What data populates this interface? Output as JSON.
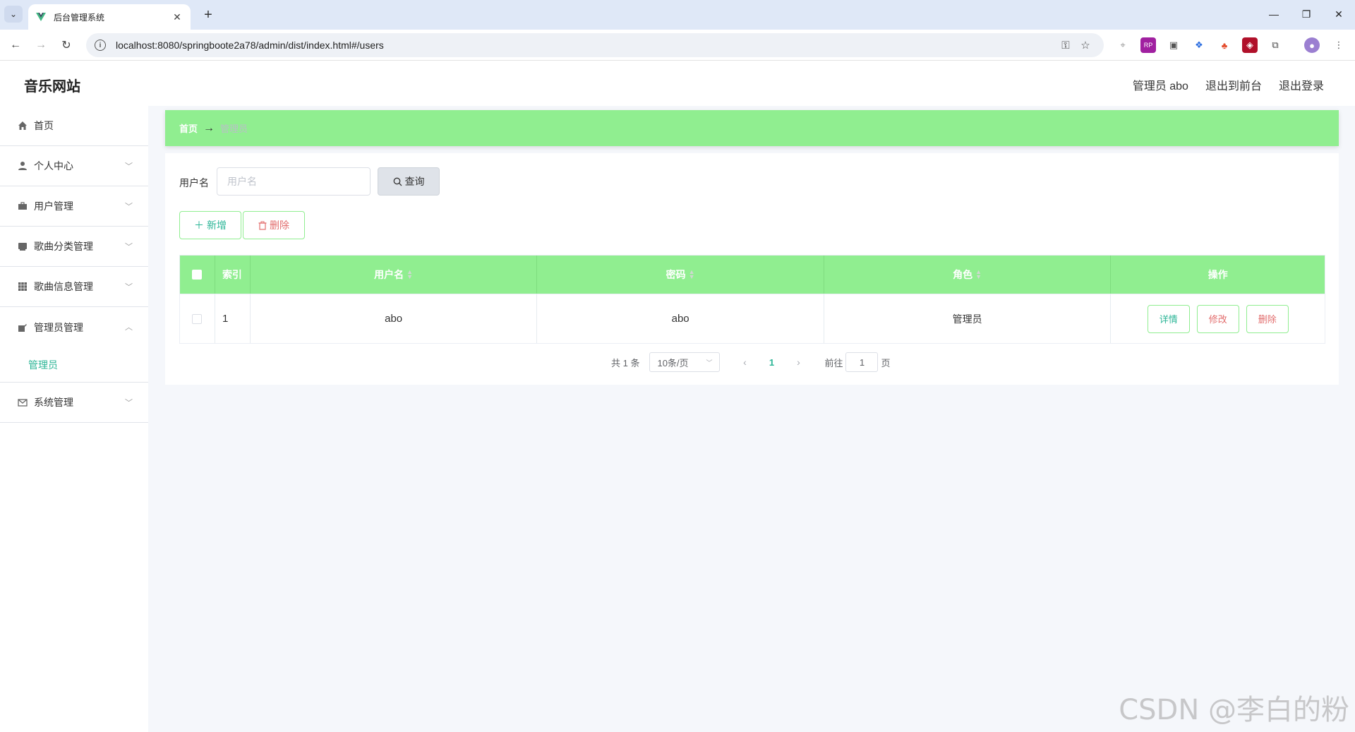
{
  "browser": {
    "tab_title": "后台管理系统",
    "url": "localhost:8080/springboote2a78/admin/dist/index.html#/users"
  },
  "header": {
    "site_title": "音乐网站",
    "admin_label": "管理员 abo",
    "back_to_front": "退出到前台",
    "logout": "退出登录"
  },
  "sidebar": {
    "items": [
      {
        "label": "首页",
        "icon": "home-icon"
      },
      {
        "label": "个人中心",
        "icon": "user-icon"
      },
      {
        "label": "用户管理",
        "icon": "briefcase-icon"
      },
      {
        "label": "歌曲分类管理",
        "icon": "folder-icon"
      },
      {
        "label": "歌曲信息管理",
        "icon": "grid-icon"
      },
      {
        "label": "管理员管理",
        "icon": "edit-icon"
      },
      {
        "label": "系统管理",
        "icon": "mail-icon"
      }
    ],
    "sub_item": "管理员"
  },
  "breadcrumb": {
    "home": "首页",
    "separator": "→",
    "current": "管理员"
  },
  "search": {
    "label": "用户名",
    "placeholder": "用户名",
    "button": "查询"
  },
  "actions": {
    "add": "新增",
    "delete": "删除"
  },
  "table": {
    "columns": [
      "索引",
      "用户名",
      "密码",
      "角色",
      "操作"
    ],
    "rows": [
      {
        "index": "1",
        "username": "abo",
        "password": "abo",
        "role": "管理员"
      }
    ],
    "row_buttons": {
      "detail": "详情",
      "edit": "修改",
      "delete": "删除"
    }
  },
  "pagination": {
    "total": "共 1 条",
    "page_size": "10条/页",
    "current_page": "1",
    "goto_label": "前往",
    "goto_value": "1",
    "page_unit": "页"
  },
  "watermark": "CSDN @李白的粉",
  "colors": {
    "accent": "#90ee90",
    "link": "#2bb596",
    "danger": "#e26d6d"
  }
}
